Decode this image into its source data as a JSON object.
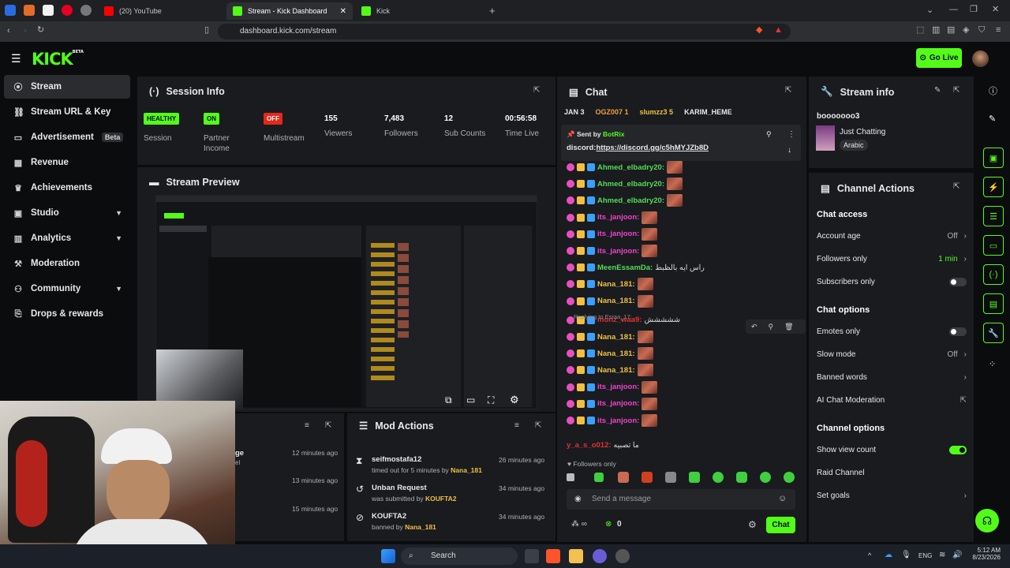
{
  "browser": {
    "tabs": [
      {
        "label": "(20) YouTube",
        "color": "#ff0000"
      },
      {
        "label": "Stream - Kick Dashboard",
        "color": "#53fc18",
        "active": true
      },
      {
        "label": "Kick",
        "color": "#53fc18"
      }
    ],
    "url": "dashboard.kick.com/stream"
  },
  "header": {
    "logo": "KICK",
    "logo_tag": "BETA",
    "go_live": "Go Live"
  },
  "sidebar": {
    "items": [
      {
        "label": "Stream",
        "icon": "broadcast-icon"
      },
      {
        "label": "Stream URL & Key",
        "icon": "link-icon"
      },
      {
        "label": "Advertisement",
        "icon": "ad-icon",
        "badge": "Beta"
      },
      {
        "label": "Revenue",
        "icon": "wallet-icon"
      },
      {
        "label": "Achievements",
        "icon": "trophy-icon"
      },
      {
        "label": "Studio",
        "icon": "studio-icon"
      },
      {
        "label": "Analytics",
        "icon": "chart-icon"
      },
      {
        "label": "Moderation",
        "icon": "hammer-icon"
      },
      {
        "label": "Community",
        "icon": "people-icon"
      },
      {
        "label": "Drops & rewards",
        "icon": "gift-icon"
      }
    ]
  },
  "session": {
    "title": "Session Info",
    "stats": [
      {
        "badge": "HEALTHY",
        "label": "Session",
        "color": "#53fc18"
      },
      {
        "badge": "ON",
        "label": "Partner Income",
        "color": "#53fc18"
      },
      {
        "badge": "OFF",
        "label": "Multistream",
        "color": "#e5281a"
      },
      {
        "value": "155",
        "label": "Viewers"
      },
      {
        "value": "7,483",
        "label": "Followers"
      },
      {
        "value": "12",
        "label": "Sub Counts"
      },
      {
        "value": "00:56:58",
        "label": "Time Live"
      }
    ]
  },
  "preview": {
    "title": "Stream Preview"
  },
  "mod_actions": {
    "title": "Mod Actions",
    "items": [
      {
        "title": "seifmostafa12",
        "sub": "timed out for 5 minutes by ",
        "by": "Nana_181",
        "time": "26 minutes ago",
        "icon": "hourglass-icon"
      },
      {
        "title": "Unban Request",
        "sub": "was submitted by ",
        "by": "KOUFTA2",
        "time": "34 minutes ago",
        "icon": "history-icon"
      },
      {
        "title": "KOUFTA2",
        "sub": "banned by ",
        "by": "Nana_181",
        "time": "34 minutes ago",
        "icon": "ban-icon"
      }
    ]
  },
  "left_panel": {
    "times": [
      "12 minutes ago",
      "13 minutes ago",
      "15 minutes ago"
    ],
    "partial": [
      "ge",
      "el"
    ]
  },
  "chat": {
    "title": "Chat",
    "leaderboard": [
      "JAN 3",
      "OGZ007 1",
      "slumzz3 5",
      "KARIM_HEME"
    ],
    "pinned": {
      "sent_by": "Sent by",
      "bot": "BotRix",
      "prefix": "discord:",
      "link": "https://discord.gg/c5hMYJZb8D"
    },
    "messages": [
      {
        "user": "Ahmed_elbadry20:",
        "color": "#55dd55",
        "text": ""
      },
      {
        "user": "Ahmed_elbadry20:",
        "color": "#55dd55",
        "text": ""
      },
      {
        "user": "Ahmed_elbadry20:",
        "color": "#55dd55",
        "text": ""
      },
      {
        "user": "its_janjoon:",
        "color": "#ee44cc",
        "text": ""
      },
      {
        "user": "its_janjoon:",
        "color": "#ee44cc",
        "text": ""
      },
      {
        "user": "its_janjoon:",
        "color": "#ee44cc",
        "text": ""
      },
      {
        "user": "MeenEssamDa:",
        "color": "#55dd55",
        "text": "راس ايه بالظبط"
      },
      {
        "user": "Nana_181:",
        "color": "#f0c040",
        "text": ""
      },
      {
        "user": "Nana_181:",
        "color": "#f0c040",
        "text": ""
      },
      {
        "user": "monz_waa9:",
        "color": "#e53030",
        "text": "ششششش"
      },
      {
        "user": "Nana_181:",
        "color": "#f0c040",
        "text": ""
      },
      {
        "user": "Nana_181:",
        "color": "#f0c040",
        "text": ""
      },
      {
        "user": "Nana_181:",
        "color": "#f0c040",
        "text": ""
      },
      {
        "user": "its_janjoon:",
        "color": "#ee44cc",
        "text": ""
      },
      {
        "user": "its_janjoon:",
        "color": "#ee44cc",
        "text": ""
      },
      {
        "user": "its_janjoon:",
        "color": "#ee44cc",
        "text": ""
      }
    ],
    "reply_to": "Replying to Esraa_17:",
    "last_user": "y_a_s_o012:",
    "last_text": "ما تصبيه",
    "followers_only": "Followers only",
    "placeholder": "Send a message",
    "count": "0",
    "send": "Chat"
  },
  "stream_info": {
    "title": "Stream info",
    "channel": "booooooo3",
    "category": "Just Chatting",
    "language": "Arabic"
  },
  "channel_actions": {
    "title": "Channel Actions",
    "chat_access": "Chat access",
    "account_age": "Account age",
    "account_age_v": "Off",
    "followers_only": "Followers only",
    "followers_only_v": "1 min",
    "subscribers_only": "Subscribers only",
    "chat_options": "Chat options",
    "emotes_only": "Emotes only",
    "slow_mode": "Slow mode",
    "slow_mode_v": "Off",
    "banned_words": "Banned words",
    "ai_mod": "AI Chat Moderation",
    "channel_options": "Channel options",
    "show_view_count": "Show view count",
    "raid": "Raid Channel",
    "goals": "Set goals"
  },
  "taskbar": {
    "search": "Search",
    "lang": "ENG",
    "time": "5:12 AM",
    "date": "8/23/2026"
  }
}
